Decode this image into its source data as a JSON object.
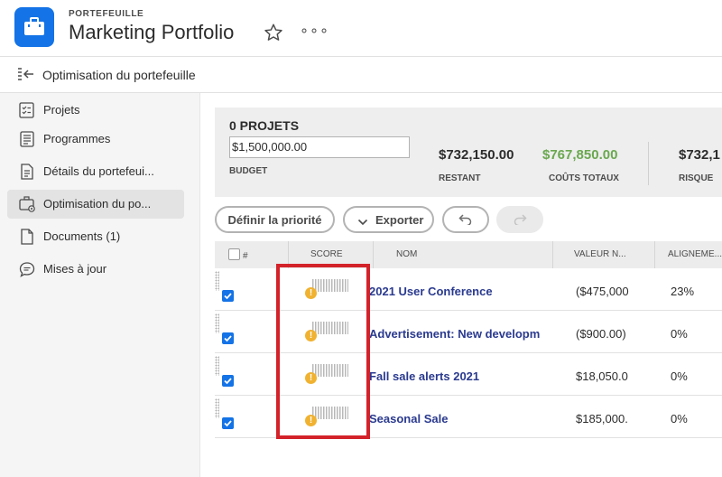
{
  "header": {
    "kicker": "PORTEFEUILLE",
    "title": "Marketing Portfolio",
    "more": "∘∘∘"
  },
  "section": {
    "title": "Optimisation du portefeuille"
  },
  "sidebar": {
    "items": [
      {
        "label": "Projets",
        "icon": "checklist-icon"
      },
      {
        "label": "Programmes",
        "icon": "list-icon"
      },
      {
        "label": "Détails du portefeui...",
        "icon": "document-icon"
      },
      {
        "label": "Optimisation du po...",
        "icon": "briefcase-gear-icon",
        "active": true
      },
      {
        "label": "Documents (1)",
        "icon": "file-icon"
      },
      {
        "label": "Mises à jour",
        "icon": "chat-icon"
      }
    ]
  },
  "summary": {
    "count": "0 PROJETS",
    "budget_value": "$1,500,000.00",
    "budget_label": "BUDGET",
    "restant_value": "$732,150.00",
    "restant_label": "RESTANT",
    "couts_value": "$767,850.00",
    "couts_label": "COÛTS TOTAUX",
    "couts_color": "#6aa84f",
    "risque_value": "$732,1",
    "risque_label": "RISQUE"
  },
  "toolbar": {
    "priority_label": "Définir la priorité",
    "export_label": "Exporter"
  },
  "table": {
    "headers": {
      "num": "#",
      "score": "SCORE",
      "name": "NOM",
      "value": "VALEUR N...",
      "align": "ALIGNEME..."
    },
    "rows": [
      {
        "name": "2021 User Conference",
        "value": "($475,000",
        "align": "23%",
        "checked": true
      },
      {
        "name": "Advertisement: New developm",
        "value": "($900.00)",
        "align": "0%",
        "checked": true
      },
      {
        "name": "Fall sale alerts 2021",
        "value": "$18,050.0",
        "align": "0%",
        "checked": true
      },
      {
        "name": "Seasonal Sale",
        "value": "$185,000.",
        "align": "0%",
        "checked": true
      }
    ],
    "warning_glyph": "!"
  },
  "colors": {
    "accent": "#1473e6",
    "highlight": "#d3222a",
    "link": "#2a3a8f"
  }
}
